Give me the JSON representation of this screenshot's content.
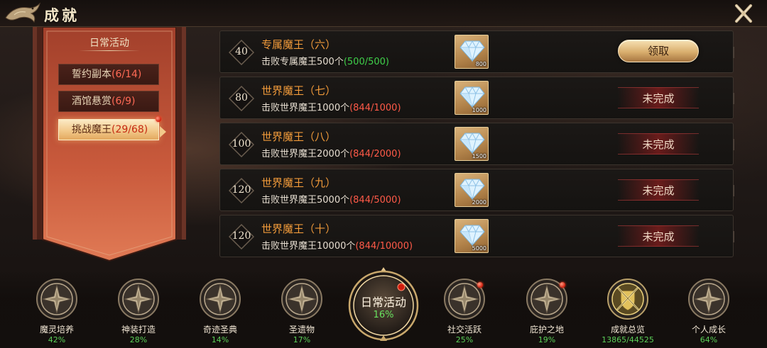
{
  "header": {
    "title": "成就"
  },
  "sidebar": {
    "title": "日常活动",
    "tabs": [
      {
        "label": "誓约副本",
        "count": "(6/14)",
        "active": false
      },
      {
        "label": "酒馆悬赏",
        "count": "(6/9)",
        "active": false
      },
      {
        "label": "挑战魔王",
        "count": "(29/68)",
        "active": true
      }
    ]
  },
  "achievements": [
    {
      "points": "40",
      "title": "专属魔王（六）",
      "desc": "击败专属魔王500个",
      "progress": "(500/500)",
      "done": true,
      "reward_qty": "800",
      "action": "领取"
    },
    {
      "points": "80",
      "title": "世界魔王（七）",
      "desc": "击败世界魔王1000个",
      "progress": "(844/1000)",
      "done": false,
      "reward_qty": "1000",
      "action": "未完成"
    },
    {
      "points": "100",
      "title": "世界魔王（八）",
      "desc": "击败世界魔王2000个",
      "progress": "(844/2000)",
      "done": false,
      "reward_qty": "1500",
      "action": "未完成"
    },
    {
      "points": "120",
      "title": "世界魔王（九）",
      "desc": "击败世界魔王5000个",
      "progress": "(844/5000)",
      "done": false,
      "reward_qty": "2000",
      "action": "未完成"
    },
    {
      "points": "120",
      "title": "世界魔王（十）",
      "desc": "击败世界魔王10000个",
      "progress": "(844/10000)",
      "done": false,
      "reward_qty": "5000",
      "action": "未完成"
    }
  ],
  "bottom_nav": [
    {
      "label": "魔灵培养",
      "value": "42%",
      "icon": "compass-star-icon",
      "dot": false
    },
    {
      "label": "神装打造",
      "value": "28%",
      "icon": "compass-star-icon",
      "dot": false
    },
    {
      "label": "奇迹圣典",
      "value": "14%",
      "icon": "compass-star-icon",
      "dot": false
    },
    {
      "label": "圣遗物",
      "value": "17%",
      "icon": "compass-star-icon",
      "dot": false
    },
    {
      "label": "日常活动",
      "value": "16%",
      "icon": "compass-star-icon",
      "dot": true,
      "active": true
    },
    {
      "label": "社交活跃",
      "value": "25%",
      "icon": "compass-star-icon",
      "dot": true
    },
    {
      "label": "庇护之地",
      "value": "19%",
      "icon": "compass-star-icon",
      "dot": true
    },
    {
      "label": "成就总览",
      "value": "13865/44525",
      "icon": "crossed-swords-shield-icon",
      "dot": false
    },
    {
      "label": "个人成长",
      "value": "64%",
      "icon": "compass-star-icon",
      "dot": false
    }
  ],
  "colors": {
    "accent_orange": "#f09a3a",
    "progress_done": "#3fd14a",
    "progress_pending": "#ff5a48",
    "percent_green": "#5bcf58"
  }
}
